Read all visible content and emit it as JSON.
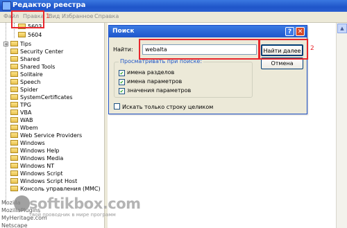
{
  "window": {
    "title": "Редактор реестра"
  },
  "menu": {
    "file": "Файл",
    "edit": "Правка",
    "view": "Вид",
    "favorites": "Избранное",
    "help": "Справка"
  },
  "annotations": {
    "step1": "1",
    "step2": "2"
  },
  "tree": {
    "subkeys": [
      "5603",
      "5604"
    ],
    "items": [
      "Tips",
      "Security Center",
      "Shared",
      "Shared Tools",
      "Solitaire",
      "Speech",
      "Spider",
      "SystemCertificates",
      "TPG",
      "VBA",
      "WAB",
      "Wbem",
      "Web Service Providers",
      "Windows",
      "Windows Help",
      "Windows Media",
      "Windows NT",
      "Windows Script",
      "Windows Script Host",
      "Консоль управления (MMC)"
    ],
    "bottom_items": [
      "Mozilla",
      "MozillaPlugins",
      "MyHeritage.com",
      "Netscape"
    ]
  },
  "dialog": {
    "title": "Поиск",
    "help_glyph": "?",
    "close_glyph": "✕",
    "find_label": "Найти:",
    "find_value": "webalta",
    "find_next": "Найти далее",
    "cancel": "Отмена",
    "look_at_label": "Просматривать при поиске:",
    "checks": [
      {
        "label": "имена разделов",
        "checked": true
      },
      {
        "label": "имена параметров",
        "checked": true
      },
      {
        "label": "значения параметров",
        "checked": true
      }
    ],
    "whole_string": {
      "label": "Искать только строку целиком",
      "checked": false
    }
  },
  "watermark": {
    "brand": "softikbox.com",
    "tagline": "твой проводник в мире программ"
  },
  "colors": {
    "highlight": "#e8262c",
    "titlebar": "#1f55c9",
    "dialog_bg": "#ece9d8"
  }
}
